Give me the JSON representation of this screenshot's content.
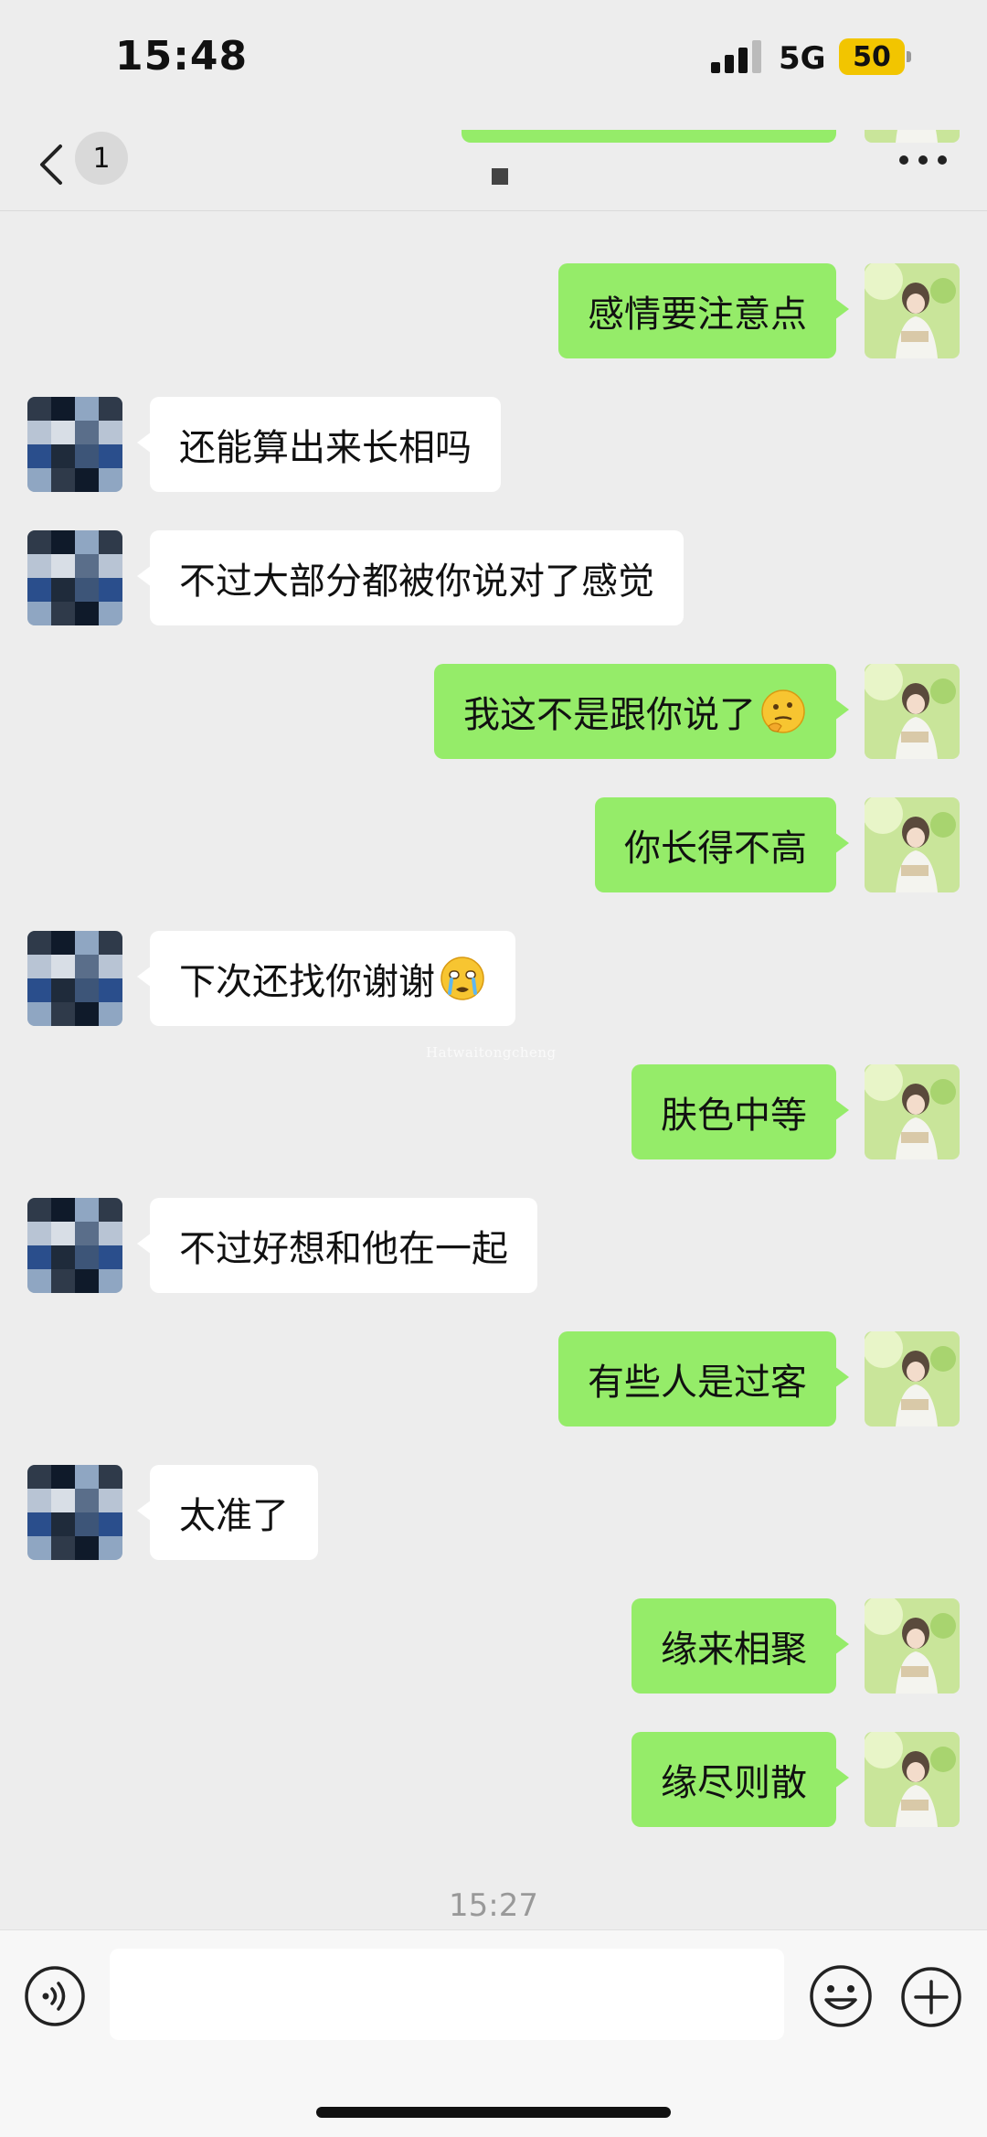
{
  "status_bar": {
    "time": "15:48",
    "network": "5G",
    "battery": "50"
  },
  "header": {
    "unread_count": "1"
  },
  "messages": [
    {
      "side": "right",
      "text": "感情要注意点"
    },
    {
      "side": "left",
      "text": "还能算出来长相吗"
    },
    {
      "side": "left",
      "text": "不过大部分都被你说对了感觉"
    },
    {
      "side": "right",
      "text": "我这不是跟你说了",
      "emoji": "thinking-face"
    },
    {
      "side": "right",
      "text": "你长得不高"
    },
    {
      "side": "left",
      "text": "下次还找你谢谢",
      "emoji": "crying-face"
    },
    {
      "side": "right",
      "text": "肤色中等"
    },
    {
      "side": "left",
      "text": "不过好想和他在一起"
    },
    {
      "side": "right",
      "text": "有些人是过客"
    },
    {
      "side": "left",
      "text": "太准了"
    },
    {
      "side": "right",
      "text": "缘来相聚"
    },
    {
      "side": "right",
      "text": "缘尽则散"
    }
  ],
  "watermark": "Hatwaitongcheng",
  "timestamp": "15:27",
  "input": {
    "value": "",
    "placeholder": ""
  },
  "colors": {
    "sent_bubble": "#95ec69",
    "received_bubble": "#ffffff",
    "background": "#ededed"
  }
}
